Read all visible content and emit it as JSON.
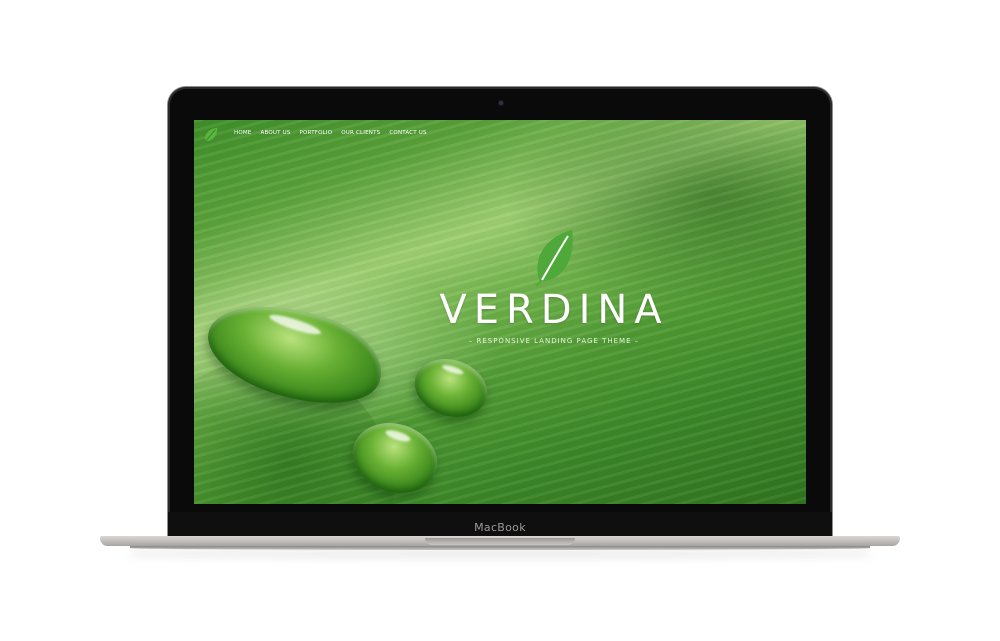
{
  "device": {
    "brand_label": "MacBook"
  },
  "site": {
    "nav": {
      "logo_icon": "leaf-icon",
      "items": [
        {
          "label": "HOME"
        },
        {
          "label": "ABOUT US"
        },
        {
          "label": "PORTFOLIO"
        },
        {
          "label": "OUR CLIENTS"
        },
        {
          "label": "CONTACT US"
        }
      ]
    },
    "hero": {
      "icon": "leaf-icon",
      "title": "VERDINA",
      "tagline": "RESPONSIVE LANDING PAGE THEME"
    },
    "colors": {
      "leaf_green": "#4fa83a",
      "text": "#ffffff"
    }
  }
}
